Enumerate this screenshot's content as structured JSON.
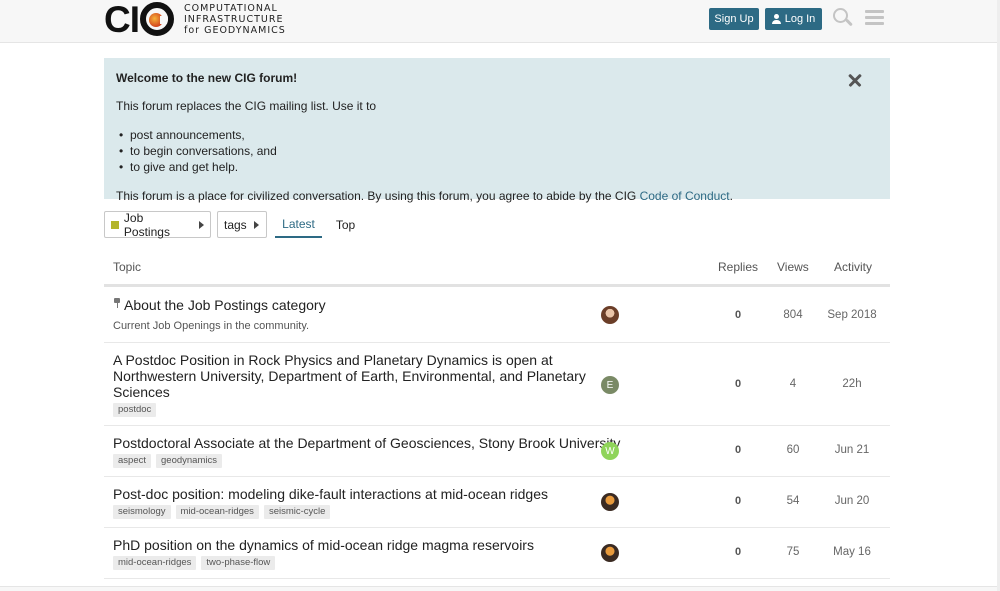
{
  "header": {
    "logo_mark_left": "CI",
    "logo_text_line1": "COMPUTATIONAL",
    "logo_text_line2": "INFRASTRUCTURE",
    "logo_text_line3": "for GEODYNAMICS",
    "signup_label": "Sign Up",
    "login_label": "Log In",
    "icons": [
      "user-icon",
      "search-icon",
      "hamburger-icon"
    ]
  },
  "banner": {
    "title": "Welcome to the new CIG forum!",
    "intro": "This forum replaces the CIG mailing list. Use it to",
    "items": [
      "post announcements,",
      "to begin conversations, and",
      "to give and get help."
    ],
    "footer_text": "This forum is a place for civilized conversation. By using this forum, you agree to abide by the CIG ",
    "footer_link": "Code of Conduct",
    "footer_end": ".",
    "close_icon": "close-icon"
  },
  "nav": {
    "category_label": "Job Postings",
    "category_color": "#b3b52c",
    "tags_label": "tags",
    "tabs": [
      {
        "label": "Latest",
        "active": true
      },
      {
        "label": "Top",
        "active": false
      }
    ]
  },
  "table": {
    "headers": {
      "topic": "Topic",
      "replies": "Replies",
      "views": "Views",
      "activity": "Activity"
    },
    "rows": [
      {
        "title": "About the Job Postings category",
        "pinned": true,
        "excerpt": "Current Job Openings in the community.",
        "tags": [],
        "avatar": "photo",
        "replies": "0",
        "views": "804",
        "activity": "Sep 2018"
      },
      {
        "title_lines": [
          "A Postdoc Position in Rock Physics and Planetary Dynamics is open at",
          "Northwestern University, Department of Earth, Environmental, and Planetary",
          "Sciences"
        ],
        "tags": [
          "postdoc"
        ],
        "avatar_letter": "E",
        "avatar_color": "#7a8a66",
        "replies": "0",
        "views": "4",
        "activity": "22h"
      },
      {
        "title": "Postdoctoral Associate at the Department of Geosciences, Stony Brook University",
        "tags": [
          "aspect",
          "geodynamics"
        ],
        "avatar_letter": "W",
        "avatar_color": "#8fd45a",
        "replies": "0",
        "views": "60",
        "activity": "Jun 21"
      },
      {
        "title": "Post-doc position: modeling dike-fault interactions at mid-ocean ridges",
        "tags": [
          "seismology",
          "mid-ocean-ridges",
          "seismic-cycle"
        ],
        "avatar": "photo",
        "replies": "0",
        "views": "54",
        "activity": "Jun 20"
      },
      {
        "title": "PhD position on the dynamics of mid-ocean ridge magma reservoirs",
        "tags": [
          "mid-ocean-ridges",
          "two-phase-flow"
        ],
        "avatar": "photo",
        "replies": "0",
        "views": "75",
        "activity": "May 16"
      }
    ]
  }
}
